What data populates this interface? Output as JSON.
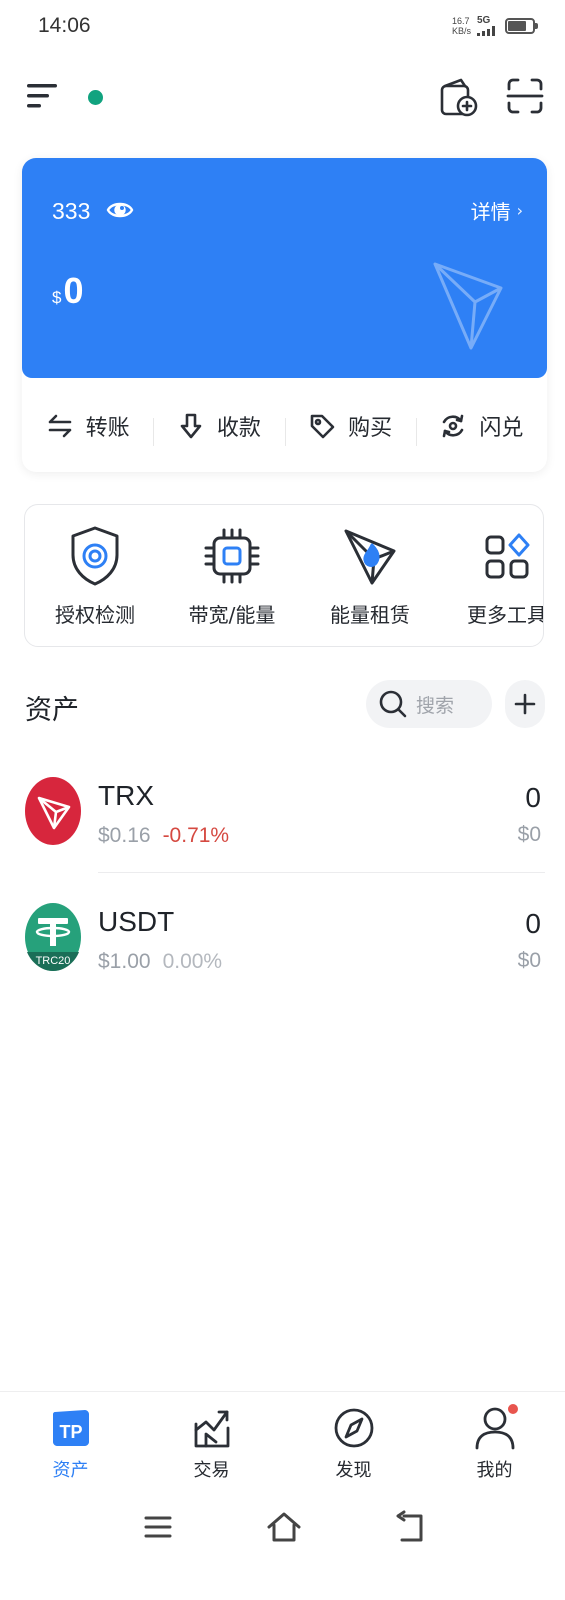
{
  "status_bar": {
    "time": "14:06",
    "net_speed_value": "16.7",
    "net_speed_unit": "KB/s",
    "network": "5G",
    "battery_level": 0.75
  },
  "wallet": {
    "name": "333",
    "detail_label": "详情",
    "balance_currency": "$",
    "balance_value": "0",
    "card_color": "#2e80f5",
    "actions": [
      {
        "label": "转账",
        "icon": "transfer-icon"
      },
      {
        "label": "收款",
        "icon": "receive-icon"
      },
      {
        "label": "购买",
        "icon": "buy-tag-icon"
      },
      {
        "label": "闪兑",
        "icon": "swap-icon"
      }
    ]
  },
  "tools": [
    {
      "label": "授权检测",
      "icon": "shield-check-icon"
    },
    {
      "label": "带宽/能量",
      "icon": "chip-icon"
    },
    {
      "label": "能量租赁",
      "icon": "energy-rent-icon"
    },
    {
      "label": "更多工具",
      "icon": "more-tools-icon"
    }
  ],
  "assets": {
    "title": "资产",
    "search_placeholder": "搜索",
    "items": [
      {
        "symbol": "TRX",
        "price": "$0.16",
        "change": "-0.71%",
        "amount": "0",
        "value": "$0",
        "logo": "tron-logo-icon"
      },
      {
        "symbol": "USDT",
        "price": "$1.00",
        "change": "0.00%",
        "amount": "0",
        "value": "$0",
        "logo": "tether-trc20-logo-icon",
        "logo_text": "TRC20"
      }
    ]
  },
  "bottom_nav": [
    {
      "label": "资产",
      "icon": "tp-wallet-icon",
      "active": true
    },
    {
      "label": "交易",
      "icon": "trade-chart-icon",
      "active": false
    },
    {
      "label": "发现",
      "icon": "compass-icon",
      "active": false
    },
    {
      "label": "我的",
      "icon": "profile-icon",
      "active": false,
      "badge": true
    }
  ],
  "colors": {
    "accent": "#2e80f5",
    "online": "#11a37f",
    "negative": "#d54941",
    "trx_red": "#d7263d",
    "usdt_green": "#26a17b"
  }
}
